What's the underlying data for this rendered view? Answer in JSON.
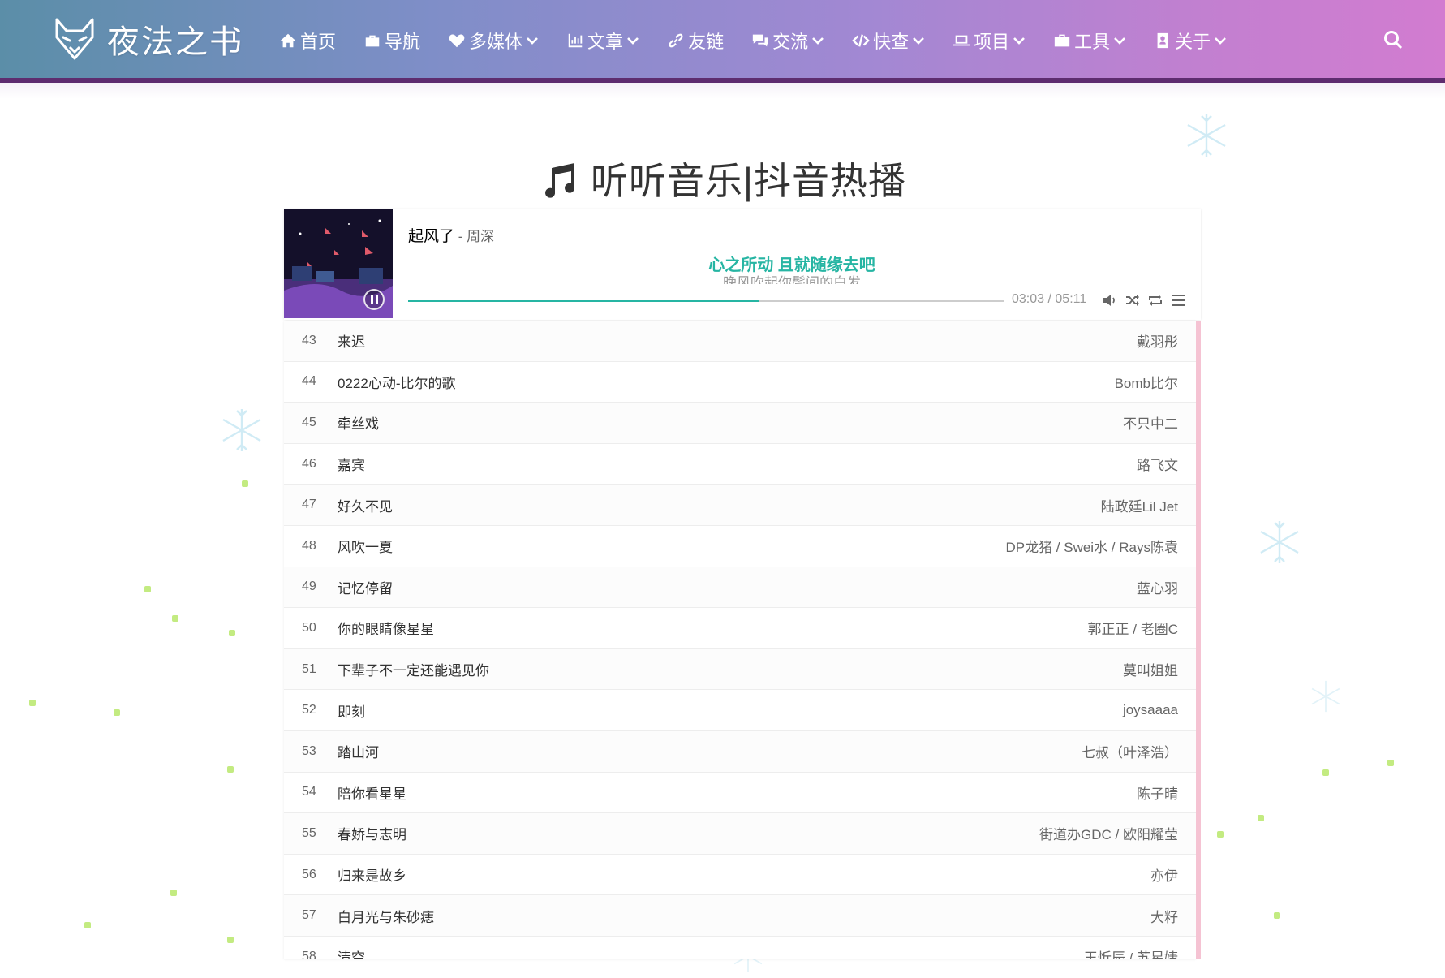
{
  "site": {
    "logo_text": "夜法之书"
  },
  "nav": {
    "items": [
      {
        "label": "首页",
        "icon": "home-icon",
        "dropdown": false
      },
      {
        "label": "导航",
        "icon": "briefcase-icon",
        "dropdown": false
      },
      {
        "label": "多媒体",
        "icon": "heart-icon",
        "dropdown": true
      },
      {
        "label": "文章",
        "icon": "chart-icon",
        "dropdown": true
      },
      {
        "label": "友链",
        "icon": "link-icon",
        "dropdown": false
      },
      {
        "label": "交流",
        "icon": "comments-icon",
        "dropdown": true
      },
      {
        "label": "快查",
        "icon": "code-icon",
        "dropdown": true
      },
      {
        "label": "项目",
        "icon": "laptop-icon",
        "dropdown": true
      },
      {
        "label": "工具",
        "icon": "toolbox-icon",
        "dropdown": true
      },
      {
        "label": "关于",
        "icon": "contact-card-icon",
        "dropdown": true
      }
    ]
  },
  "page": {
    "title": "听听音乐|抖音热播"
  },
  "player": {
    "song_title": "起风了",
    "separator": " - ",
    "song_artist": "周深",
    "lyric_current": "心之所动 且就随缘去吧",
    "lyric_next": "晚风吹起你鬓间的白发",
    "time_current": "03:03",
    "time_total": "05:11",
    "time_sep": " / ",
    "progress": 0.588,
    "accent_color": "#26b5a3"
  },
  "playlist": [
    {
      "index": "43",
      "title": "来迟",
      "author": "戴羽彤"
    },
    {
      "index": "44",
      "title": "0222心动-比尔的歌",
      "author": "Bomb比尔"
    },
    {
      "index": "45",
      "title": "牵丝戏",
      "author": "不只中二"
    },
    {
      "index": "46",
      "title": "嘉宾",
      "author": "路飞文"
    },
    {
      "index": "47",
      "title": "好久不见",
      "author": "陆政廷Lil Jet"
    },
    {
      "index": "48",
      "title": "风吹一夏",
      "author": "DP龙猪 / Swei水 / Rays陈袁"
    },
    {
      "index": "49",
      "title": "记忆停留",
      "author": "蓝心羽"
    },
    {
      "index": "50",
      "title": "你的眼睛像星星",
      "author": "郭正正 / 老圈C"
    },
    {
      "index": "51",
      "title": "下辈子不一定还能遇见你",
      "author": "莫叫姐姐"
    },
    {
      "index": "52",
      "title": "即刻",
      "author": "joysaaaa"
    },
    {
      "index": "53",
      "title": "踏山河",
      "author": "七叔（叶泽浩）"
    },
    {
      "index": "54",
      "title": "陪你看星星",
      "author": "陈子晴"
    },
    {
      "index": "55",
      "title": "春娇与志明",
      "author": "街道办GDC / 欧阳耀莹"
    },
    {
      "index": "56",
      "title": "归来是故乡",
      "author": "亦伊"
    },
    {
      "index": "57",
      "title": "白月光与朱砂痣",
      "author": "大籽"
    },
    {
      "index": "58",
      "title": "清空",
      "author": "王忻辰 / 苏星婕"
    }
  ]
}
